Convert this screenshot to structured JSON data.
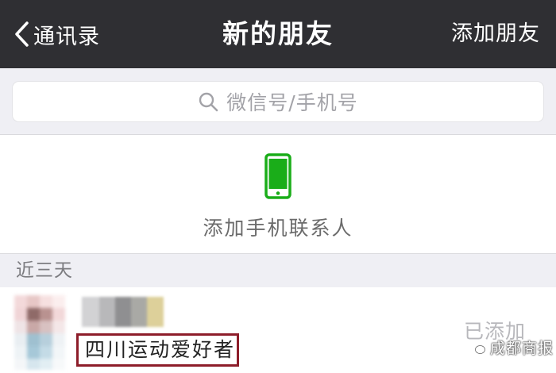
{
  "navbar": {
    "back_label": "通讯录",
    "title": "新的朋友",
    "action_label": "添加朋友",
    "background": "#2f2f33"
  },
  "search": {
    "placeholder": "微信号/手机号",
    "icon": "search-icon"
  },
  "add_contacts": {
    "label": "添加手机联系人",
    "icon": "mobile-phone-icon",
    "icon_color": "#1aad19"
  },
  "sections": [
    {
      "header": "近三天",
      "items": [
        {
          "note": "四川运动爱好者",
          "status": "已添加",
          "highlight_color": "#8d1d2a"
        }
      ]
    }
  ],
  "watermark": {
    "text": "成都商报",
    "icon": "wechat-icon"
  }
}
